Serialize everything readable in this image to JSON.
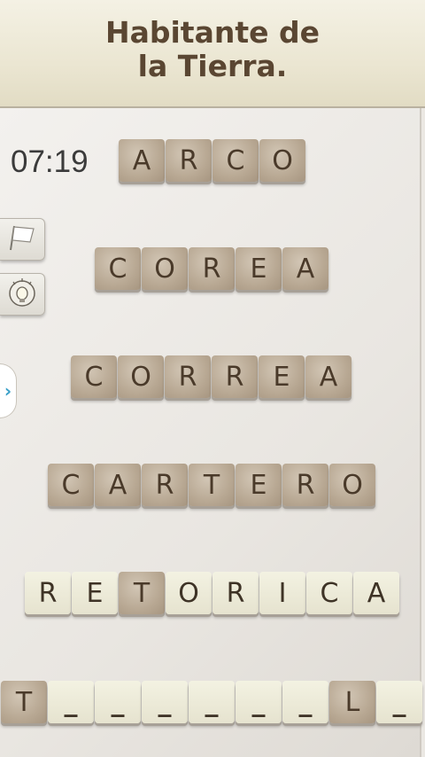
{
  "clue": {
    "line1": "Habitante de",
    "line2": "la Tierra."
  },
  "timer": "07:19",
  "side_buttons": {
    "flag_icon": "flag-icon",
    "hint_icon": "lightbulb-icon",
    "arrow": "›"
  },
  "word_rows": [
    {
      "tiles": [
        {
          "letter": "A",
          "style": "brown"
        },
        {
          "letter": "R",
          "style": "brown"
        },
        {
          "letter": "C",
          "style": "brown"
        },
        {
          "letter": "O",
          "style": "brown"
        }
      ]
    },
    {
      "tiles": [
        {
          "letter": "C",
          "style": "brown"
        },
        {
          "letter": "O",
          "style": "brown"
        },
        {
          "letter": "R",
          "style": "brown"
        },
        {
          "letter": "E",
          "style": "brown"
        },
        {
          "letter": "A",
          "style": "brown"
        }
      ]
    },
    {
      "tiles": [
        {
          "letter": "C",
          "style": "brown"
        },
        {
          "letter": "O",
          "style": "brown"
        },
        {
          "letter": "R",
          "style": "brown"
        },
        {
          "letter": "R",
          "style": "brown"
        },
        {
          "letter": "E",
          "style": "brown"
        },
        {
          "letter": "A",
          "style": "brown"
        }
      ]
    },
    {
      "tiles": [
        {
          "letter": "C",
          "style": "brown"
        },
        {
          "letter": "A",
          "style": "brown"
        },
        {
          "letter": "R",
          "style": "brown"
        },
        {
          "letter": "T",
          "style": "brown"
        },
        {
          "letter": "E",
          "style": "brown"
        },
        {
          "letter": "R",
          "style": "brown"
        },
        {
          "letter": "O",
          "style": "brown"
        }
      ]
    },
    {
      "tiles": [
        {
          "letter": "R",
          "style": "cream"
        },
        {
          "letter": "E",
          "style": "cream"
        },
        {
          "letter": "T",
          "style": "brown"
        },
        {
          "letter": "O",
          "style": "cream"
        },
        {
          "letter": "R",
          "style": "cream"
        },
        {
          "letter": "I",
          "style": "cream"
        },
        {
          "letter": "C",
          "style": "cream"
        },
        {
          "letter": "A",
          "style": "cream"
        }
      ]
    },
    {
      "tiles": [
        {
          "letter": "T",
          "style": "brown"
        },
        {
          "letter": "_",
          "style": "cream"
        },
        {
          "letter": "_",
          "style": "cream"
        },
        {
          "letter": "_",
          "style": "cream"
        },
        {
          "letter": "_",
          "style": "cream"
        },
        {
          "letter": "_",
          "style": "cream"
        },
        {
          "letter": "_",
          "style": "cream"
        },
        {
          "letter": "L",
          "style": "brown"
        },
        {
          "letter": "_",
          "style": "cream"
        }
      ]
    }
  ]
}
